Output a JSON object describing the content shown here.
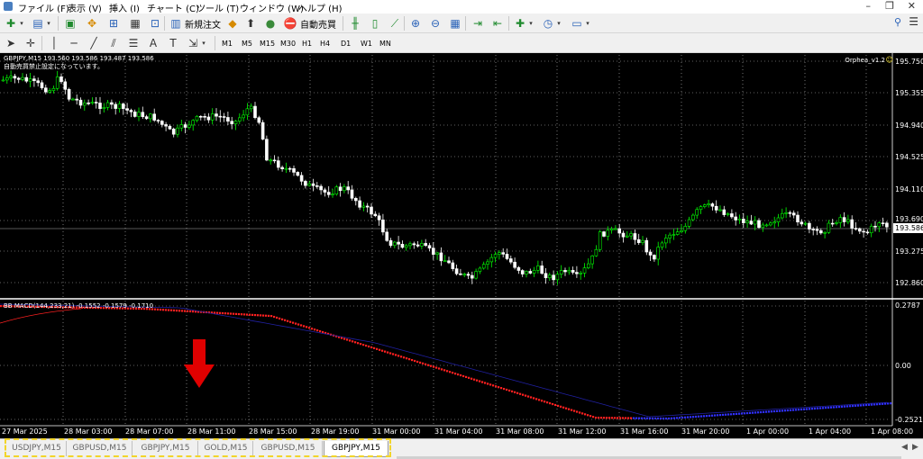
{
  "menu": {
    "items": [
      "ファイル (F)",
      "表示 (V)",
      "挿入 (I)",
      "チャート (C)",
      "ツール (T)",
      "ウィンドウ (W)",
      "ヘルプ (H)"
    ]
  },
  "toolbar": {
    "new_order_label": "新規注文",
    "auto_trade_label": "自動売買",
    "timeframes": [
      "M1",
      "M5",
      "M15",
      "M30",
      "H1",
      "H4",
      "D1",
      "W1",
      "MN"
    ]
  },
  "chart": {
    "symbol_info": "GBPJPY,M15  193.560 193.586 193.487 193.586",
    "notice": "自動売買禁止設定になっています。",
    "ea_name": "Orphea_v1.2",
    "ea_smiley": "☺",
    "current_price": "193.586",
    "price_ticks": [
      "195.750",
      "195.355",
      "194.940",
      "194.525",
      "194.110",
      "193.690",
      "193.275",
      "192.860"
    ],
    "indicator_label": "BB MACD(144,233,21) -0.1552 -0.1579 -0.1710",
    "indicator_ticks": [
      "0.2787",
      "0.00",
      "-0.2521"
    ],
    "time_ticks": [
      "27 Mar 2025",
      "28 Mar 03:00",
      "28 Mar 07:00",
      "28 Mar 11:00",
      "28 Mar 15:00",
      "28 Mar 19:00",
      "31 Mar 00:00",
      "31 Mar 04:00",
      "31 Mar 08:00",
      "31 Mar 12:00",
      "31 Mar 16:00",
      "31 Mar 20:00",
      "1 Apr 00:00",
      "1 Apr 04:00",
      "1 Apr 08:00"
    ],
    "colors": {
      "background": "#000000",
      "grid": "#c0c0c0",
      "candle_up": "#00ff00",
      "candle_down": "#ffffff",
      "macd_down": "#ff2020",
      "macd_up": "#3030ff",
      "signal": "#2020a0",
      "arrow": "#e00000"
    }
  },
  "tabs": [
    {
      "label": "USDJPY,M15",
      "active": false
    },
    {
      "label": "GBPUSD,M15",
      "active": false
    },
    {
      "label": "GBPJPY,M15",
      "active": false
    },
    {
      "label": "GOLD,M15",
      "active": false
    },
    {
      "label": "GBPUSD,M15",
      "active": false
    },
    {
      "label": "GBPJPY,M15",
      "active": true
    }
  ],
  "tab_highlight_color": "#f2d52a"
}
